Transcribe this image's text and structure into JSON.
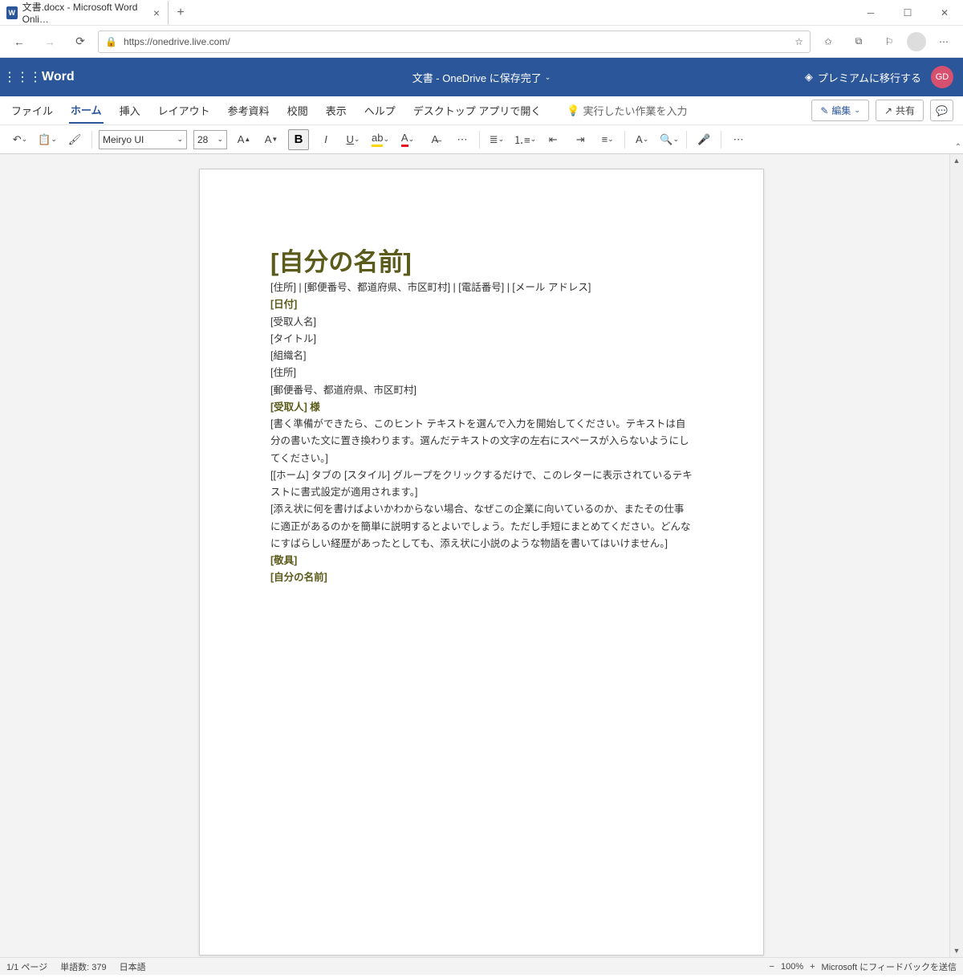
{
  "browser": {
    "tab_title": "文書.docx - Microsoft Word Onli…",
    "url": "https://onedrive.live.com/"
  },
  "appbar": {
    "app_name": "Word",
    "doc_title": "文書 - OneDrive に保存完了",
    "premium": "プレミアムに移行する",
    "avatar": "GD"
  },
  "ribbon": {
    "tabs": [
      "ファイル",
      "ホーム",
      "挿入",
      "レイアウト",
      "参考資料",
      "校閲",
      "表示",
      "ヘルプ",
      "デスクトップ アプリで開く"
    ],
    "active": "ホーム",
    "search_placeholder": "実行したい作業を入力",
    "edit": "編集",
    "share": "共有"
  },
  "toolbar": {
    "font_name": "Meiryo UI",
    "font_size": "28"
  },
  "document": {
    "title": "[自分の名前]",
    "contact_line": "[住所] | [郵便番号、都道府県、市区町村] | [電話番号] | [メール アドレス]",
    "date": "[日付]",
    "recipient": "[受取人名]",
    "title_line": "[タイトル]",
    "org": "[組織名]",
    "addr": "[住所]",
    "postal": "[郵便番号、都道府県、市区町村]",
    "salutation": "[受取人] 様",
    "p1": "[書く準備ができたら、このヒント テキストを選んで入力を開始してください。テキストは自分の書いた文に置き換わります。選んだテキストの文字の左右にスペースが入らないようにしてください。]",
    "p2": "[[ホーム] タブの [スタイル] グループをクリックするだけで、このレターに表示されているテキストに書式設定が適用されます。]",
    "p3": "[添え状に何を書けばよいかわからない場合、なぜこの企業に向いているのか、またその仕事に適正があるのかを簡単に説明するとよいでしょう。ただし手短にまとめてください。どんなにすばらしい経歴があったとしても、添え状に小説のような物語を書いてはいけません。]",
    "closing": "[敬具]",
    "signature": "[自分の名前]"
  },
  "status": {
    "page": "1/1 ページ",
    "words": "単語数: 379",
    "lang": "日本語",
    "zoom": "100%",
    "feedback": "Microsoft にフィードバックを送信"
  }
}
